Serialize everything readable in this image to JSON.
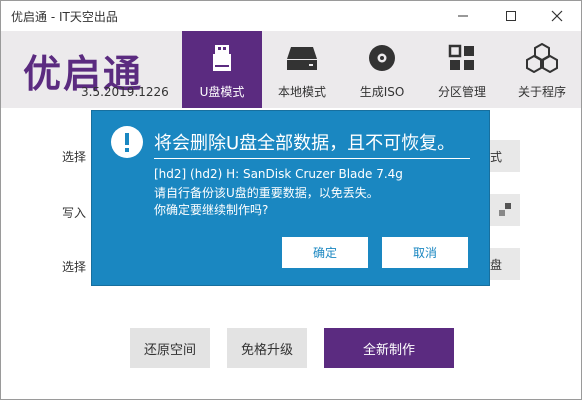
{
  "window": {
    "title": "优启通 - IT天空出品"
  },
  "header": {
    "logo_text": "优启通",
    "version": "3.5.2019.1226",
    "nav": [
      {
        "label": "U盘模式",
        "icon": "usb-drive-icon",
        "active": true
      },
      {
        "label": "本地模式",
        "icon": "hard-disk-icon",
        "active": false
      },
      {
        "label": "生成ISO",
        "icon": "disc-icon",
        "active": false
      },
      {
        "label": "分区管理",
        "icon": "grid-icon",
        "active": false
      },
      {
        "label": "关于程序",
        "icon": "cubes-icon",
        "active": false
      }
    ]
  },
  "form": {
    "label1": "选择",
    "label2": "写入",
    "label3": "选择",
    "side_btn1": "式",
    "side_btn3": "盘"
  },
  "bottom": {
    "restore": "还原空间",
    "upgrade": "免格升级",
    "create": "全新制作"
  },
  "dialog": {
    "heading": "将会删除U盘全部数据，且不可恢复。",
    "device": "[hd2] (hd2) H: SanDisk Cruzer Blade 7.4g",
    "backup_note": "请自行备份该U盘的重要数据，以免丢失。",
    "confirm_question": "你确定要继续制作吗?",
    "ok_label": "确定",
    "cancel_label": "取消"
  },
  "colors": {
    "accent": "#5b2b80",
    "dialog_bg": "#1a87c1"
  }
}
